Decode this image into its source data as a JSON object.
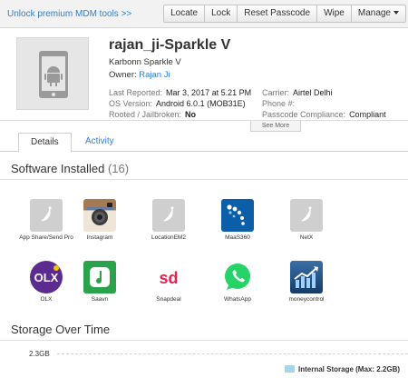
{
  "topbar": {
    "unlock_link": "Unlock premium MDM tools >>",
    "actions": [
      "Locate",
      "Lock",
      "Reset Passcode",
      "Wipe",
      "Manage"
    ]
  },
  "device": {
    "name": "rajan_ji-Sparkle V",
    "model": "Karbonn Sparkle V",
    "owner_label": "Owner:",
    "owner_name": "Rajan Ji",
    "last_reported_label": "Last Reported:",
    "last_reported": "Mar 3, 2017 at 5.21 PM",
    "os_label": "OS Version:",
    "os": "Android 6.0.1 (MOB31E)",
    "rooted_label": "Rooted / Jailbroken:",
    "rooted": "No",
    "carrier_label": "Carrier:",
    "carrier": "Airtel Delhi",
    "phone_label": "Phone #:",
    "phone": "",
    "passcode_label": "Passcode Compliance:",
    "passcode": "Compliant",
    "see_more": "See More"
  },
  "tabs": {
    "details": "Details",
    "activity": "Activity"
  },
  "software": {
    "title": "Software Installed",
    "count": "(16)",
    "apps": [
      {
        "name": "App Share/Send Pro",
        "icon": "generic-app-icon"
      },
      {
        "name": "Instagram",
        "icon": "instagram-icon"
      },
      {
        "name": "LocationEM2",
        "icon": "generic-app-icon"
      },
      {
        "name": "MaaS360",
        "icon": "maas360-icon"
      },
      {
        "name": "NetX",
        "icon": "generic-app-icon"
      },
      {
        "name": "OLX",
        "icon": "olx-icon"
      },
      {
        "name": "Saavn",
        "icon": "saavn-icon"
      },
      {
        "name": "Snapdeal",
        "icon": "snapdeal-icon"
      },
      {
        "name": "WhatsApp",
        "icon": "whatsapp-icon"
      },
      {
        "name": "moneycontrol",
        "icon": "moneycontrol-icon"
      }
    ]
  },
  "storage": {
    "title": "Storage Over Time",
    "axis_value": "2.3GB",
    "legend": "Internal Storage (Max: 2.2GB)"
  },
  "colors": {
    "link": "#2f7fd1",
    "olx": "#5c2b8f",
    "saavn": "#2aa34a",
    "snapdeal": "#e4234f",
    "whatsapp": "#25d366",
    "maas360": "#0a5fa8",
    "moneycontrol": "#1c4f82"
  }
}
